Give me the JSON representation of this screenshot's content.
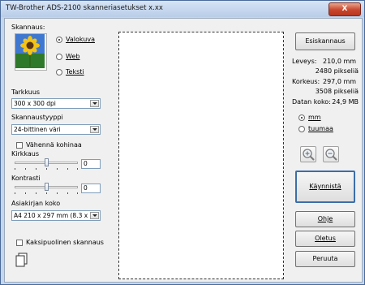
{
  "window": {
    "title": "TW-Brother ADS-2100 skanneriasetukset   x.xx",
    "close_label": "X"
  },
  "scan": {
    "label": "Skannaus:",
    "options": [
      {
        "label": "Valokuva",
        "selected": true
      },
      {
        "label": "Web",
        "selected": false
      },
      {
        "label": "Teksti",
        "selected": false
      }
    ]
  },
  "resolution": {
    "label": "Tarkkuus",
    "value": "300 x 300 dpi"
  },
  "scan_type": {
    "label": "Skannaustyyppi",
    "value": "24-bittinen väri"
  },
  "reduce_noise": {
    "label": "Vähennä kohinaa",
    "checked": false
  },
  "brightness": {
    "label": "Kirkkaus",
    "value": "0"
  },
  "contrast": {
    "label": "Kontrasti",
    "value": "0"
  },
  "doc_size": {
    "label": "Asiakirjan koko",
    "value": "A4 210 x 297 mm (8.3 x 11.7..."
  },
  "duplex": {
    "label": "Kaksipuolinen skannaus",
    "checked": false
  },
  "buttons": {
    "prescan": "Esiskannaus",
    "start": "Käynnistä",
    "help": "Ohje",
    "default": "Oletus",
    "cancel": "Peruuta"
  },
  "info": {
    "width_label": "Leveys:",
    "width_mm": "210,0 mm",
    "width_px": "2480 pikseliä",
    "height_label": "Korkeus:",
    "height_mm": "297,0 mm",
    "height_px": "3508 pikseliä",
    "size_label": "Datan koko:",
    "size_value": "24,9 MB"
  },
  "units": {
    "options": [
      {
        "label": "mm",
        "selected": true
      },
      {
        "label": "tuumaa",
        "selected": false
      }
    ]
  },
  "icons": {
    "photo": "sunflower-photo-icon",
    "zoom_in": "zoom-in-icon",
    "zoom_out": "zoom-out-icon",
    "duplex": "duplex-pages-icon"
  }
}
